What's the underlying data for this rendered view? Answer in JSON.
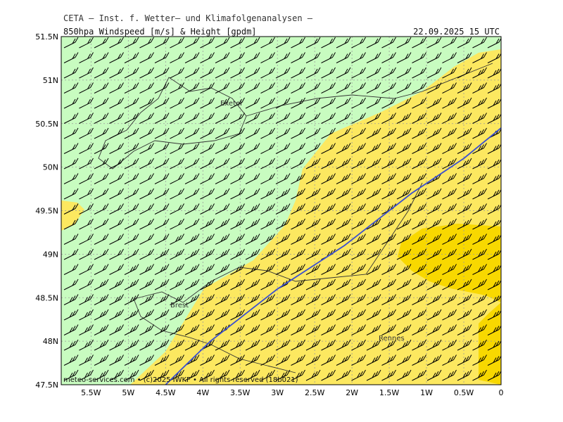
{
  "header": {
    "title": "CETA – Inst. f. Wetter– und Klimafolgenanalysen –",
    "subtitle": "850hpa Windspeed [m/s] & Height [gpdm]",
    "datetime": "22.09.2025 15 UTC"
  },
  "footer": {
    "copyright": "meteo-services.com • (c)2025 IWKF • All rights reserved (18b021)"
  },
  "axes": {
    "lat_labels": [
      "51.5N",
      "51N",
      "50.5N",
      "50N",
      "49.5N",
      "49N",
      "48.5N",
      "48N",
      "47.5N"
    ],
    "lon_labels": [
      "5.5W",
      "5W",
      "4.5W",
      "4W",
      "3.5W",
      "3W",
      "2.5W",
      "2W",
      "1.5W",
      "1W",
      "0.5W",
      "0"
    ]
  },
  "cities": [
    "Exeter",
    "Brest",
    "Rennes"
  ],
  "colors": {
    "low_wind": "#c8fcc0",
    "mid_wind": "#fce860",
    "high_wind": "#f8d800",
    "height_contour": "#3a4fd0"
  },
  "chart_data": {
    "type": "heatmap",
    "region_lon": [
      -5.9,
      0
    ],
    "region_lat": [
      47.5,
      51.5
    ],
    "height_contour": {
      "points": [
        [
          -4.5,
          47.5
        ],
        [
          -3.9,
          48.0
        ],
        [
          -3.0,
          48.6
        ],
        [
          -2.1,
          49.1
        ],
        [
          -1.2,
          49.7
        ],
        [
          -0.5,
          50.1
        ],
        [
          0.0,
          50.45
        ]
      ]
    },
    "wind_direction_from": "west-southwest"
  }
}
